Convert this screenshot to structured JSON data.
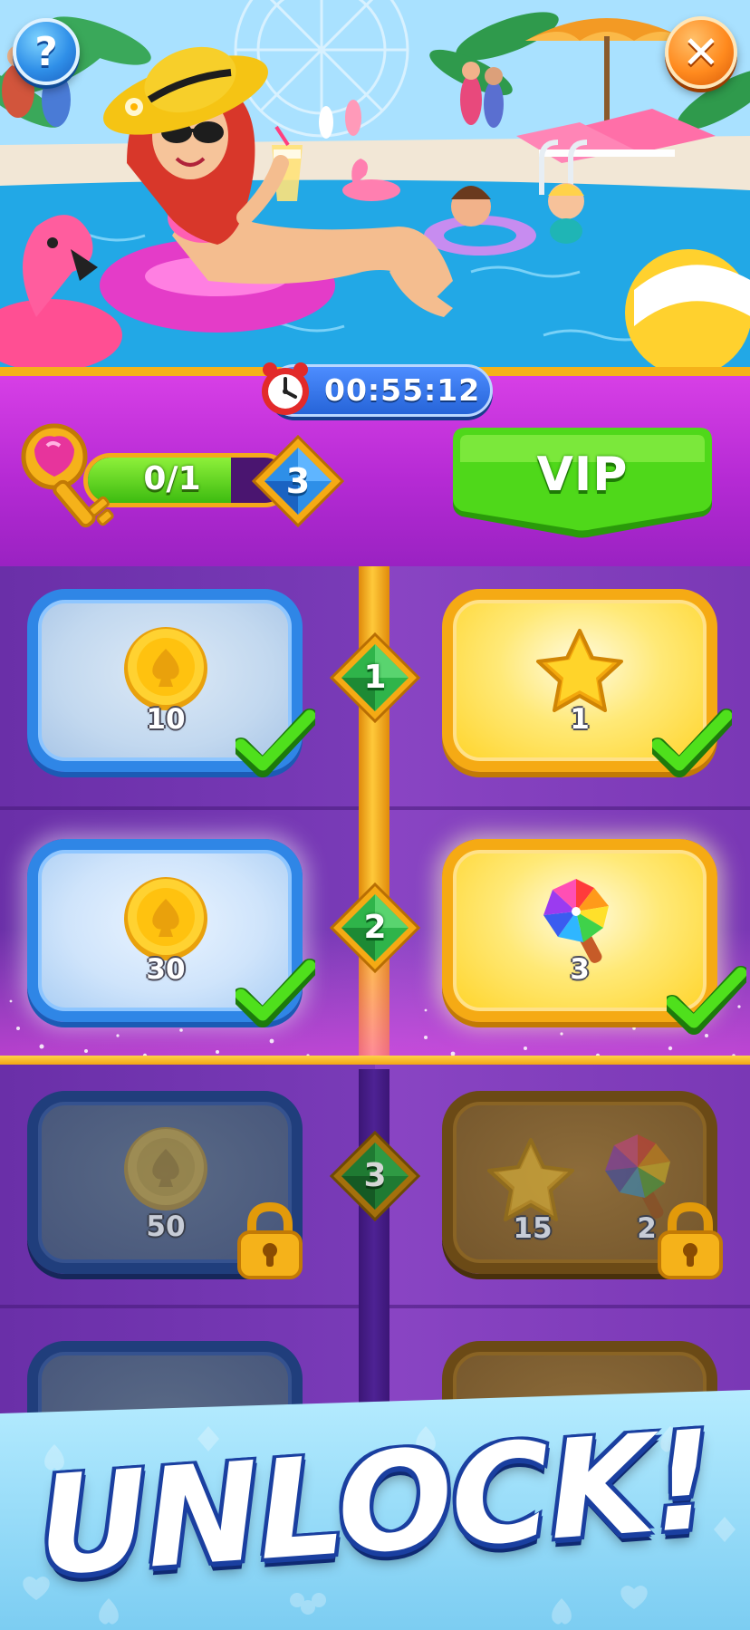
{
  "header": {
    "help_label": "?",
    "close_label": "✕",
    "timer": "00:55:12",
    "progress": {
      "text": "0/1",
      "fraction": 0
    },
    "level": "3",
    "vip_label": "VIP"
  },
  "tiers": [
    {
      "tier": "1",
      "free": {
        "icon": "spade-coin-icon",
        "amount": "10",
        "state": "claimed"
      },
      "premium": {
        "icon": "star-icon",
        "amount": "1",
        "state": "claimed"
      }
    },
    {
      "tier": "2",
      "free": {
        "icon": "spade-coin-icon",
        "amount": "30",
        "state": "claimed"
      },
      "premium": {
        "icon": "pinwheel-lollipop-icon",
        "amount": "3",
        "state": "claimed"
      }
    },
    {
      "tier": "3",
      "free": {
        "icon": "spade-coin-icon",
        "amount": "50",
        "state": "locked"
      },
      "premium": [
        {
          "icon": "star-icon",
          "amount": "15"
        },
        {
          "icon": "pinwheel-lollipop-icon",
          "amount": "2"
        }
      ],
      "premium_state": "locked"
    }
  ],
  "banner": {
    "text": "UNLOCK!"
  },
  "colors": {
    "header_band": "#c234dc",
    "grid_bg": "#6b35a8",
    "gold_accent": "#f5aa14",
    "blue_card_border": "#2f86e6",
    "vip_green": "#3dbb10",
    "banner_blue": "#8fd6f5"
  }
}
